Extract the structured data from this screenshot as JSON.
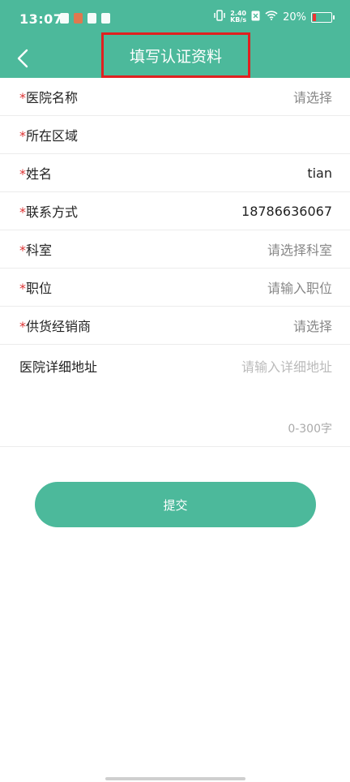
{
  "status_bar": {
    "time": "13:07",
    "net_speed_value": "2.40",
    "net_speed_unit": "KB/s",
    "battery": "20%"
  },
  "header": {
    "title": "填写认证资料"
  },
  "form": {
    "required_mark": "*",
    "rows": [
      {
        "label": "医院名称",
        "value": "请选择"
      },
      {
        "label": "所在区域",
        "value": ""
      },
      {
        "label": "姓名",
        "value": "tian"
      },
      {
        "label": "联系方式",
        "value": "18786636067"
      },
      {
        "label": "科室",
        "value": "请选择科室"
      },
      {
        "label": "职位",
        "value": "请输入职位"
      },
      {
        "label": "供货经销商",
        "value": "请选择"
      }
    ],
    "address": {
      "label": "医院详细地址",
      "placeholder": "请输入详细地址",
      "counter": "0-300字"
    }
  },
  "submit_label": "提交",
  "colors": {
    "primary": "#4cb99b",
    "highlight_box": "#e02020",
    "required": "#dd3333"
  }
}
